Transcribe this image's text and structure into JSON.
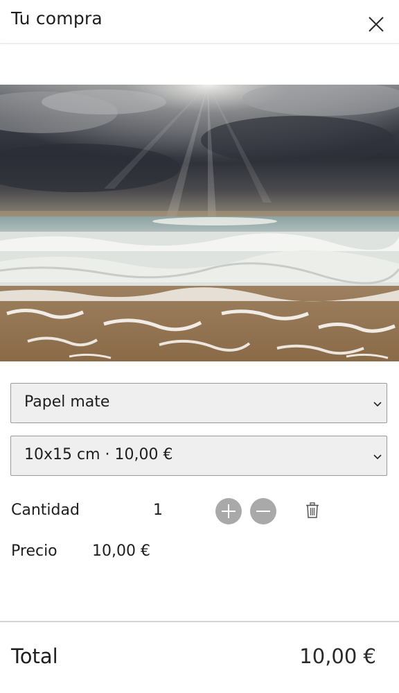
{
  "header": {
    "title": "Tu compra",
    "close_icon": "close-icon"
  },
  "product": {
    "photo_description": "beach-photo",
    "paper_select": {
      "value": "Papel mate"
    },
    "size_select": {
      "value": "10x15 cm · 10,00 €"
    }
  },
  "quantity": {
    "label": "Cantidad",
    "value": "1",
    "plus_icon": "plus-icon",
    "minus_icon": "minus-icon",
    "delete_icon": "trash-icon"
  },
  "price": {
    "label": "Precio",
    "value": "10,00 €"
  },
  "total": {
    "label": "Total",
    "value": "10,00 €"
  },
  "colors": {
    "button_gray": "#a9a9a9",
    "select_bg": "#efefef",
    "text": "#1e1e1e"
  }
}
